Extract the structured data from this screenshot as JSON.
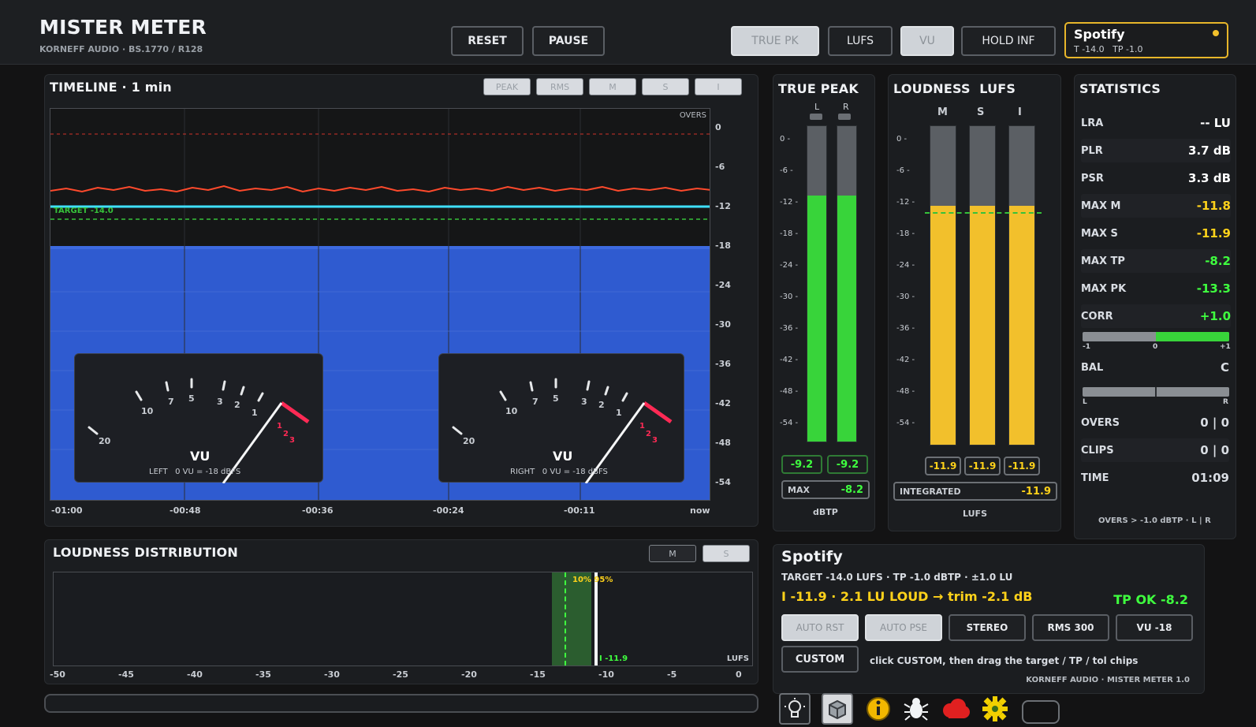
{
  "app": {
    "title": "MISTER METER",
    "subtitle": "KORNEFF AUDIO · BS.1770 / R128"
  },
  "header": {
    "reset_label": "RESET",
    "pause_label": "PAUSE",
    "modes": [
      {
        "label": "TRUE PK",
        "active": true
      },
      {
        "label": "LUFS",
        "active": false
      },
      {
        "label": "VU",
        "active": true
      },
      {
        "label": "HOLD INF",
        "active": false
      }
    ],
    "preset": {
      "name": "Spotify",
      "detail": "T -14.0   TP -1.0"
    }
  },
  "timeline": {
    "title": "TIMELINE · 1 min",
    "chips": [
      {
        "label": "PEAK",
        "active": true
      },
      {
        "label": "RMS",
        "active": true
      },
      {
        "label": "M",
        "active": true
      },
      {
        "label": "S",
        "active": true
      },
      {
        "label": "I",
        "active": true
      }
    ],
    "overs_label": "OVERS",
    "target_label": "TARGET -14.0",
    "y_ticks": [
      "0",
      "-6",
      "-12",
      "-18",
      "-24",
      "-30",
      "-36",
      "-42",
      "-48",
      "-54"
    ],
    "x_ticks": [
      "-01:00",
      "-00:48",
      "-00:36",
      "-00:24",
      "-00:11",
      "now"
    ],
    "vu_left": {
      "caption": "VU",
      "sub": "LEFT   0 VU = -18 dBFS",
      "scale": [
        "20",
        "10",
        "7",
        "5",
        "3",
        "2",
        "1"
      ],
      "red_scale": [
        "1",
        "2",
        "3"
      ]
    },
    "vu_right": {
      "caption": "VU",
      "sub": "RIGHT   0 VU = -18 dBFS",
      "scale": [
        "20",
        "10",
        "7",
        "5",
        "3",
        "2",
        "1"
      ],
      "red_scale": [
        "1",
        "2",
        "3"
      ]
    }
  },
  "true_peak": {
    "title": "TRUE PEAK",
    "channels": [
      "L",
      "R"
    ],
    "scale": [
      "0",
      "-6",
      "-12",
      "-18",
      "-24",
      "-30",
      "-36",
      "-42",
      "-48",
      "-54"
    ],
    "level_fraction": [
      0.78,
      0.78
    ],
    "readouts": [
      "-9.2",
      "-9.2"
    ],
    "max_label": "MAX",
    "max_value": "-8.2",
    "unit": "dBTP"
  },
  "loudness": {
    "title": "LOUDNESS  LUFS",
    "channels": [
      "M",
      "S",
      "I"
    ],
    "scale": [
      "0",
      "-6",
      "-12",
      "-18",
      "-24",
      "-30",
      "-36",
      "-42",
      "-48",
      "-54"
    ],
    "level_fraction": [
      0.75,
      0.75,
      0.75
    ],
    "readouts": [
      "-11.9",
      "-11.9",
      "-11.9"
    ],
    "integrated_label": "INTEGRATED",
    "integrated_value": "-11.9",
    "unit": "LUFS"
  },
  "statistics": {
    "title": "STATISTICS",
    "rows": [
      {
        "label": "LRA",
        "value": "-- LU",
        "color": "#ffffff"
      },
      {
        "label": "PLR",
        "value": "3.7 dB",
        "color": "#ffffff"
      },
      {
        "label": "PSR",
        "value": "3.3 dB",
        "color": "#ffffff"
      },
      {
        "label": "MAX M",
        "value": "-11.8",
        "color": "#ffd21a"
      },
      {
        "label": "MAX S",
        "value": "-11.9",
        "color": "#ffd21a"
      },
      {
        "label": "MAX TP",
        "value": "-8.2",
        "color": "#3fff3f"
      },
      {
        "label": "MAX PK",
        "value": "-13.3",
        "color": "#3fff3f"
      },
      {
        "label": "CORR",
        "value": "+1.0",
        "color": "#3fff3f"
      }
    ],
    "corr_ticks": [
      "-1",
      "0",
      "+1"
    ],
    "corr_fraction": 1.0,
    "bal_label": "BAL",
    "bal_value": "C",
    "bal_ticks": [
      "L",
      "R"
    ],
    "bottom_rows": [
      {
        "label": "OVERS",
        "value": "0 | 0"
      },
      {
        "label": "CLIPS",
        "value": "0 | 0"
      },
      {
        "label": "TIME",
        "value": "01:09"
      }
    ],
    "footnote": "OVERS > -1.0 dBTP · L | R"
  },
  "distribution": {
    "title": "LOUDNESS DISTRIBUTION",
    "chips": [
      {
        "label": "M",
        "active": false
      },
      {
        "label": "S",
        "active": true
      }
    ],
    "percentile_label": "10% 95%",
    "marker_label": "I -11.9",
    "unit": "LUFS",
    "x_ticks": [
      "-50",
      "-45",
      "-40",
      "-35",
      "-30",
      "-25",
      "-20",
      "-15",
      "-10",
      "-5",
      "0"
    ]
  },
  "preset_panel": {
    "title": "Spotify",
    "target_line": "TARGET -14.0 LUFS · TP -1.0 dBTP · ±1.0 LU",
    "status_line": "I -11.9 · 2.1 LU LOUD → trim -2.1 dB",
    "tp_status": "TP OK -8.2",
    "buttons": [
      {
        "label": "AUTO RST",
        "active": true
      },
      {
        "label": "AUTO PSE",
        "active": true
      },
      {
        "label": "STEREO",
        "active": false
      },
      {
        "label": "RMS 300",
        "active": false
      },
      {
        "label": "VU -18",
        "active": false
      }
    ],
    "custom_label": "CUSTOM",
    "hint": "click CUSTOM, then drag the target / TP / tol chips",
    "credit": "KORNEFF AUDIO · MISTER METER 1.0"
  },
  "toolbar_icons": [
    "lightbulb-icon",
    "box-icon",
    "info-icon",
    "bug-icon",
    "cloud-icon",
    "gear-icon",
    "blank-icon"
  ],
  "colors": {
    "accent_yellow": "#f2c02c",
    "meter_green": "#38d43a",
    "timeline_blue": "#2d57c9",
    "peak_red": "#ff3b2f",
    "target_cyan": "#3fe0ff"
  }
}
